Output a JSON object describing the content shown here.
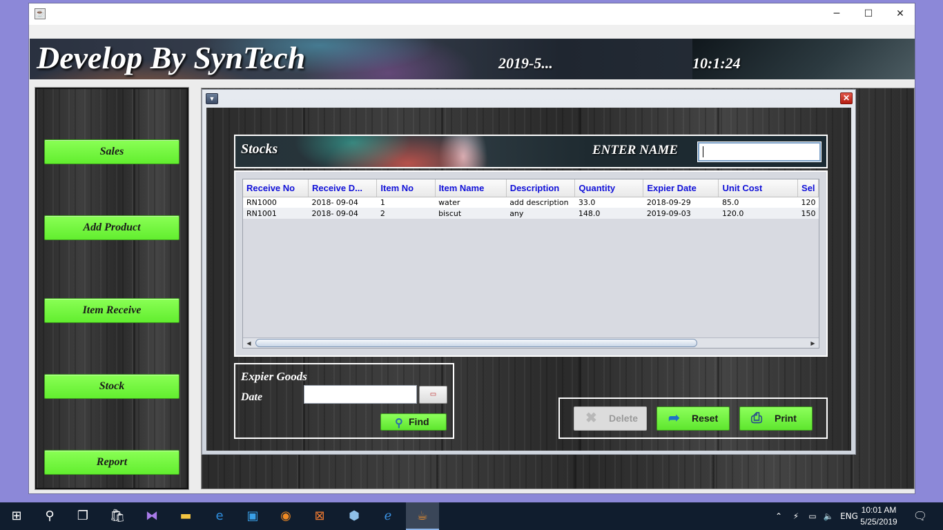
{
  "window": {
    "app_icon": "java-cup-icon",
    "controls": {
      "minimize": "─",
      "maximize": "☐",
      "close": "✕"
    }
  },
  "header": {
    "title": "Develop By SynTech",
    "date": "2019-5...",
    "time": "10:1:24"
  },
  "sidebar": {
    "items": [
      {
        "label": "Sales"
      },
      {
        "label": "Add Product"
      },
      {
        "label": "Item Receive"
      },
      {
        "label": "Stock"
      },
      {
        "label": "Report"
      }
    ]
  },
  "stocks": {
    "title": "Stocks",
    "search_label": "ENTER NAME",
    "search_value": "",
    "table": {
      "columns": [
        "Receive No",
        "Receive D...",
        "Item No",
        "Item Name",
        "Description",
        "Quantity",
        "Expier Date",
        "Unit Cost",
        "Sel"
      ],
      "rows": [
        [
          "RN1000",
          "2018- 09-04",
          "1",
          "water",
          "add description",
          "33.0",
          "2018-09-29",
          "85.0",
          "120"
        ],
        [
          "RN1001",
          "2018- 09-04",
          "2",
          "biscut",
          "any",
          "148.0",
          "2019-09-03",
          "120.0",
          "150"
        ]
      ]
    }
  },
  "expire": {
    "title": "Expier Goods",
    "date_label": "Date",
    "date_value": "",
    "find_label": "Find"
  },
  "actions": {
    "delete_label": "Delete",
    "reset_label": "Reset",
    "print_label": "Print"
  },
  "taskbar": {
    "language": "ENG",
    "time": "10:01 AM",
    "date": "5/25/2019"
  },
  "colors": {
    "accent_green": "#62ee2f",
    "column_header_text": "#1010d8",
    "taskbar": "#101d2e"
  }
}
